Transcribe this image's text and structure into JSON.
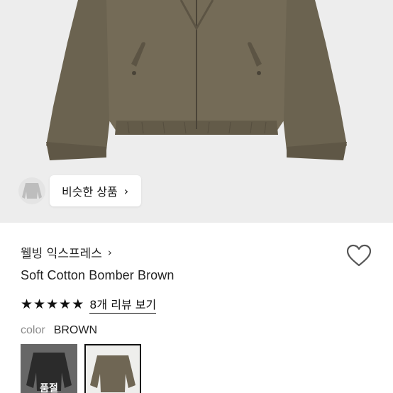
{
  "similar": {
    "label": "비슷한 상품",
    "chevron": "›"
  },
  "product": {
    "brand": "웰빙 익스프레스",
    "brand_chevron": "›",
    "title": "Soft Cotton Bomber Brown",
    "rating": {
      "stars": 5,
      "star_glyph": "★",
      "review_text": "8개 리뷰 보기"
    },
    "color": {
      "label": "color",
      "value": "BROWN"
    },
    "swatches": [
      {
        "color_name": "black",
        "status": "품절",
        "selected": false
      },
      {
        "color_name": "brown",
        "status": "",
        "selected": true
      }
    ]
  },
  "colors": {
    "jacket": "#6f6654",
    "background": "#ededed",
    "accent": "#111111"
  },
  "icons": {
    "wishlist": "heart-outline-icon",
    "chevron": "chevron-right-icon",
    "star": "star-filled-icon"
  }
}
